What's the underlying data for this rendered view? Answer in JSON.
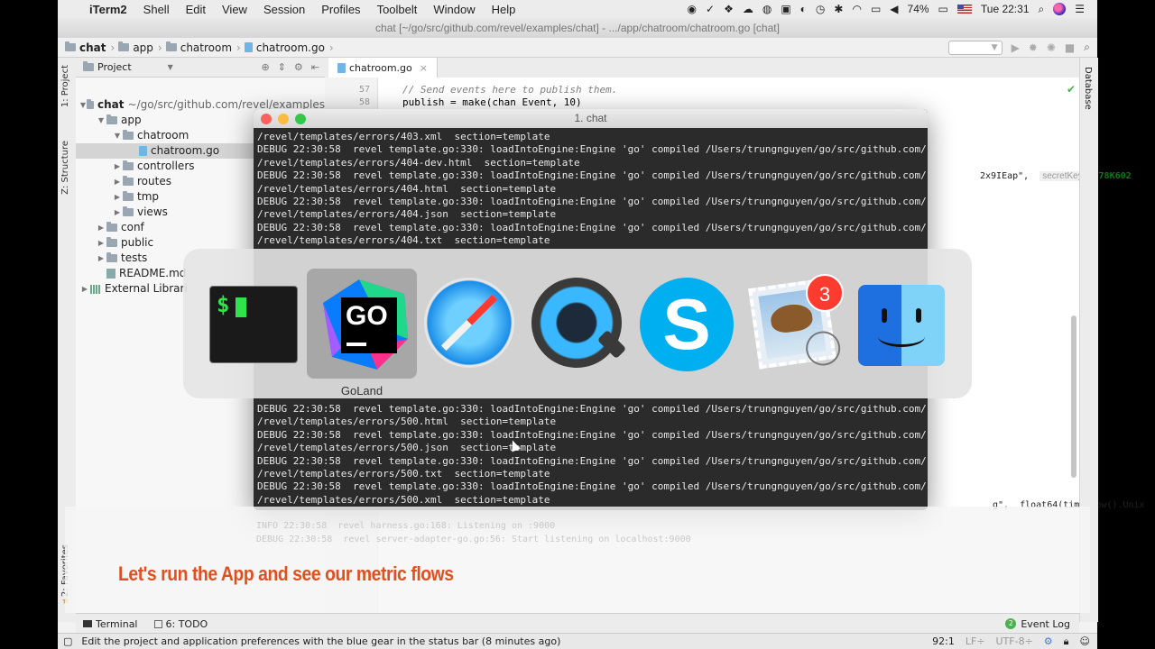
{
  "menubar": {
    "app": "iTerm2",
    "items": [
      "Shell",
      "Edit",
      "View",
      "Session",
      "Profiles",
      "Toolbelt",
      "Window",
      "Help"
    ],
    "battery": "74%",
    "clock": "Tue 22:31"
  },
  "ide": {
    "title": "chat [~/go/src/github.com/revel/examples/chat] - .../app/chatroom/chatroom.go [chat]",
    "breadcrumbs": [
      "chat",
      "app",
      "chatroom",
      "chatroom.go"
    ],
    "project_label": "Project",
    "left_tabs": [
      "1: Project",
      "Z: Structure",
      "2: Favorites"
    ],
    "right_tab": "Database",
    "tree": [
      {
        "label": "chat",
        "dim": "~/go/src/github.com/revel/examples/",
        "level": 0,
        "arrow": "▼",
        "kind": "folder",
        "bold": true
      },
      {
        "label": "app",
        "level": 1,
        "arrow": "▼",
        "kind": "folder"
      },
      {
        "label": "chatroom",
        "level": 2,
        "arrow": "▼",
        "kind": "folder"
      },
      {
        "label": "chatroom.go",
        "level": 3,
        "arrow": "",
        "kind": "go",
        "selected": true
      },
      {
        "label": "controllers",
        "level": 2,
        "arrow": "▶",
        "kind": "folder"
      },
      {
        "label": "routes",
        "level": 2,
        "arrow": "▶",
        "kind": "folder"
      },
      {
        "label": "tmp",
        "level": 2,
        "arrow": "▶",
        "kind": "folder"
      },
      {
        "label": "views",
        "level": 2,
        "arrow": "▶",
        "kind": "folder"
      },
      {
        "label": "conf",
        "level": 1,
        "arrow": "▶",
        "kind": "folder"
      },
      {
        "label": "public",
        "level": 1,
        "arrow": "▶",
        "kind": "folder"
      },
      {
        "label": "tests",
        "level": 1,
        "arrow": "▶",
        "kind": "folder"
      },
      {
        "label": "README.md",
        "level": 1,
        "arrow": "",
        "kind": "md"
      },
      {
        "label": "External Librari",
        "level": 0,
        "arrow": "▶",
        "kind": "lib"
      }
    ],
    "editor_tab": "chatroom.go",
    "code_lines": [
      {
        "n": "57",
        "text": "// Send events here to publish them."
      },
      {
        "n": "58",
        "text": "publish = make(chan Event, 10)"
      }
    ],
    "hint_right_1": "2x9IEap\",",
    "hint_right_label": "secretKey:",
    "hint_right_2": "\"78K602",
    "hint_bottom": "g\",  float64(time.Now().Unix",
    "bottom_tools": [
      {
        "label": "Terminal"
      },
      {
        "label": "6: TODO"
      }
    ],
    "event_log": "Event Log",
    "event_count": "2",
    "status_message": "Edit the project and application preferences with the blue gear in the status bar (8 minutes ago)",
    "status_pos": "92:1",
    "status_lf": "LF÷",
    "status_enc": "UTF-8÷"
  },
  "terminal": {
    "title": "1. chat",
    "lines_top": [
      "/revel/templates/errors/403.xml  section=template",
      "DEBUG 22:30:58  revel template.go:330: loadIntoEngine:Engine 'go' compiled /Users/trungnguyen/go/src/github.com/revel",
      "/revel/templates/errors/404-dev.html  section=template",
      "DEBUG 22:30:58  revel template.go:330: loadIntoEngine:Engine 'go' compiled /Users/trungnguyen/go/src/github.com/revel",
      "/revel/templates/errors/404.html  section=template",
      "DEBUG 22:30:58  revel template.go:330: loadIntoEngine:Engine 'go' compiled /Users/trungnguyen/go/src/github.com/revel",
      "/revel/templates/errors/404.json  section=template",
      "DEBUG 22:30:58  revel template.go:330: loadIntoEngine:Engine 'go' compiled /Users/trungnguyen/go/src/github.com/revel",
      "/revel/templates/errors/404.txt  section=template"
    ],
    "lines_bottom": [
      "DEBUG 22:30:58  revel template.go:330: loadIntoEngine:Engine 'go' compiled /Users/trungnguyen/go/src/github.com/revel",
      "/revel/templates/errors/500.html  section=template",
      "DEBUG 22:30:58  revel template.go:330: loadIntoEngine:Engine 'go' compiled /Users/trungnguyen/go/src/github.com/revel",
      "/revel/templates/errors/500.json  section=template",
      "DEBUG 22:30:58  revel template.go:330: loadIntoEngine:Engine 'go' compiled /Users/trungnguyen/go/src/github.com/revel",
      "/revel/templates/errors/500.txt  section=template",
      "DEBUG 22:30:58  revel template.go:330: loadIntoEngine:Engine 'go' compiled /Users/trungnguyen/go/src/github.com/revel",
      "/revel/templates/errors/500.xml  section=template"
    ],
    "ghost_lines": [
      "INFO 22:30:58  revel harness.go:168: Listening on :9000",
      "DEBUG 22:30:58  revel server-adapter-go.go:56: Start listening on localhost:9000"
    ]
  },
  "switcher": {
    "apps": [
      {
        "name": "Terminal",
        "icon": "terminal-icon",
        "label": ""
      },
      {
        "name": "GoLand",
        "icon": "goland-icon",
        "label": "GoLand",
        "selected": true
      },
      {
        "name": "Safari",
        "icon": "safari-icon",
        "label": ""
      },
      {
        "name": "QuickTime Player",
        "icon": "quicktime-icon",
        "label": ""
      },
      {
        "name": "Skype",
        "icon": "skype-icon",
        "label": ""
      },
      {
        "name": "Mail",
        "icon": "mail-icon",
        "label": "",
        "badge": "3"
      },
      {
        "name": "Finder",
        "icon": "finder-icon",
        "label": ""
      }
    ],
    "terminal_prompt": "$",
    "goland_text": "GO",
    "skype_text": "S"
  },
  "caption": "Let's run the App and see our metric flows"
}
